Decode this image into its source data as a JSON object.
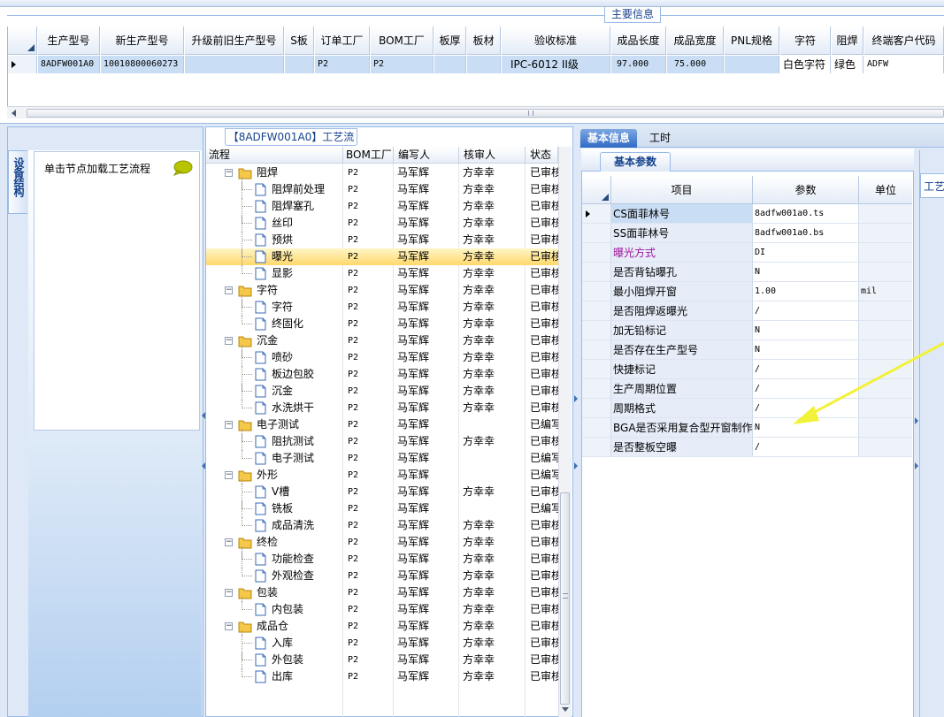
{
  "top": {
    "tab_label": "主要信息",
    "columns": [
      "生产型号",
      "新生产型号",
      "升级前旧生产型号",
      "S板",
      "订单工厂",
      "BOM工厂",
      "板厚",
      "板材",
      "验收标准",
      "成品长度",
      "成品宽度",
      "PNL规格",
      "字符",
      "阻焊",
      "终端客户代码"
    ],
    "row": [
      "8ADFW001A0",
      "10010800060273",
      "",
      "",
      "P2",
      "P2",
      "",
      "",
      "IPC-6012 II级",
      "97.000",
      "75.000",
      "",
      "白色字符",
      "绿色",
      "ADFW"
    ]
  },
  "left": {
    "vertical_tab": "设备结构",
    "hint": "单击节点加载工艺流程"
  },
  "tree": {
    "title": "【8ADFW001A0】工艺流程",
    "headers": [
      "流程",
      "BOM工厂",
      "编写人",
      "核审人",
      "状态"
    ],
    "rows": [
      {
        "name": "阻焊",
        "bom": "P2",
        "writer": "马军辉",
        "reviewer": "方幸幸",
        "status": "已审核"
      },
      {
        "name": "阻焊前处理",
        "bom": "P2",
        "writer": "马军辉",
        "reviewer": "方幸幸",
        "status": "已审核"
      },
      {
        "name": "阻焊塞孔",
        "bom": "P2",
        "writer": "马军辉",
        "reviewer": "方幸幸",
        "status": "已审核"
      },
      {
        "name": "丝印",
        "bom": "P2",
        "writer": "马军辉",
        "reviewer": "方幸幸",
        "status": "已审核"
      },
      {
        "name": "预烘",
        "bom": "P2",
        "writer": "马军辉",
        "reviewer": "方幸幸",
        "status": "已审核"
      },
      {
        "name": "曝光",
        "bom": "P2",
        "writer": "马军辉",
        "reviewer": "方幸幸",
        "status": "已审核"
      },
      {
        "name": "显影",
        "bom": "P2",
        "writer": "马军辉",
        "reviewer": "方幸幸",
        "status": "已审核"
      },
      {
        "name": "字符",
        "bom": "P2",
        "writer": "马军辉",
        "reviewer": "方幸幸",
        "status": "已审核"
      },
      {
        "name": "字符",
        "bom": "P2",
        "writer": "马军辉",
        "reviewer": "方幸幸",
        "status": "已审核"
      },
      {
        "name": "终固化",
        "bom": "P2",
        "writer": "马军辉",
        "reviewer": "方幸幸",
        "status": "已审核"
      },
      {
        "name": "沉金",
        "bom": "P2",
        "writer": "马军辉",
        "reviewer": "方幸幸",
        "status": "已审核"
      },
      {
        "name": "喷砂",
        "bom": "P2",
        "writer": "马军辉",
        "reviewer": "方幸幸",
        "status": "已审核"
      },
      {
        "name": "板边包胶",
        "bom": "P2",
        "writer": "马军辉",
        "reviewer": "方幸幸",
        "status": "已审核"
      },
      {
        "name": "沉金",
        "bom": "P2",
        "writer": "马军辉",
        "reviewer": "方幸幸",
        "status": "已审核"
      },
      {
        "name": "水洗烘干",
        "bom": "P2",
        "writer": "马军辉",
        "reviewer": "方幸幸",
        "status": "已审核"
      },
      {
        "name": "电子测试",
        "bom": "P2",
        "writer": "马军辉",
        "reviewer": "",
        "status": "已编写"
      },
      {
        "name": "阻抗测试",
        "bom": "P2",
        "writer": "马军辉",
        "reviewer": "方幸幸",
        "status": "已审核"
      },
      {
        "name": "电子测试",
        "bom": "P2",
        "writer": "马军辉",
        "reviewer": "",
        "status": "已编写"
      },
      {
        "name": "外形",
        "bom": "P2",
        "writer": "马军辉",
        "reviewer": "",
        "status": "已编写"
      },
      {
        "name": "V槽",
        "bom": "P2",
        "writer": "马军辉",
        "reviewer": "方幸幸",
        "status": "已审核"
      },
      {
        "name": "铣板",
        "bom": "P2",
        "writer": "马军辉",
        "reviewer": "",
        "status": "已编写"
      },
      {
        "name": "成品清洗",
        "bom": "P2",
        "writer": "马军辉",
        "reviewer": "方幸幸",
        "status": "已审核"
      },
      {
        "name": "终检",
        "bom": "P2",
        "writer": "马军辉",
        "reviewer": "方幸幸",
        "status": "已审核"
      },
      {
        "name": "功能检查",
        "bom": "P2",
        "writer": "马军辉",
        "reviewer": "方幸幸",
        "status": "已审核"
      },
      {
        "name": "外观检查",
        "bom": "P2",
        "writer": "马军辉",
        "reviewer": "方幸幸",
        "status": "已审核"
      },
      {
        "name": "包装",
        "bom": "P2",
        "writer": "马军辉",
        "reviewer": "方幸幸",
        "status": "已审核"
      },
      {
        "name": "内包装",
        "bom": "P2",
        "writer": "马军辉",
        "reviewer": "方幸幸",
        "status": "已审核"
      },
      {
        "name": "成品仓",
        "bom": "P2",
        "writer": "马军辉",
        "reviewer": "方幸幸",
        "status": "已审核"
      },
      {
        "name": "入库",
        "bom": "P2",
        "writer": "马军辉",
        "reviewer": "方幸幸",
        "status": "已审核"
      },
      {
        "name": "外包装",
        "bom": "P2",
        "writer": "马军辉",
        "reviewer": "方幸幸",
        "status": "已审核"
      },
      {
        "name": "出库",
        "bom": "P2",
        "writer": "马军辉",
        "reviewer": "方幸幸",
        "status": "已审核"
      }
    ]
  },
  "right": {
    "tabs": [
      "基本信息",
      "工时"
    ],
    "sub_tab": "基本参数",
    "far_tab": "工艺",
    "headers": [
      "项目",
      "参数",
      "单位"
    ],
    "params": [
      {
        "item": "CS面菲林号",
        "value": "8adfw001a0.ts",
        "unit": ""
      },
      {
        "item": "SS面菲林号",
        "value": "8adfw001a0.bs",
        "unit": ""
      },
      {
        "item": "曝光方式",
        "value": "DI",
        "unit": ""
      },
      {
        "item": "是否背钻曝孔",
        "value": "N",
        "unit": ""
      },
      {
        "item": "最小阻焊开窗",
        "value": "1.00",
        "unit": "mil"
      },
      {
        "item": "是否阻焊返曝光",
        "value": "/",
        "unit": ""
      },
      {
        "item": "加无铅标记",
        "value": "N",
        "unit": ""
      },
      {
        "item": "是否存在生产型号",
        "value": "N",
        "unit": ""
      },
      {
        "item": "快捷标记",
        "value": "/",
        "unit": ""
      },
      {
        "item": "生产周期位置",
        "value": "/",
        "unit": ""
      },
      {
        "item": "周期格式",
        "value": "/",
        "unit": ""
      },
      {
        "item": "BGA是否采用复合型开窗制作",
        "value": "N",
        "unit": ""
      },
      {
        "item": "是否整板空曝",
        "value": "/",
        "unit": ""
      }
    ]
  },
  "colors": {
    "accent": "#2f6ac4",
    "panel_border": "#99bbe8",
    "selection": "#ffd86c",
    "arrow": "#f2f23a",
    "highlight_item": "#a0149c"
  }
}
